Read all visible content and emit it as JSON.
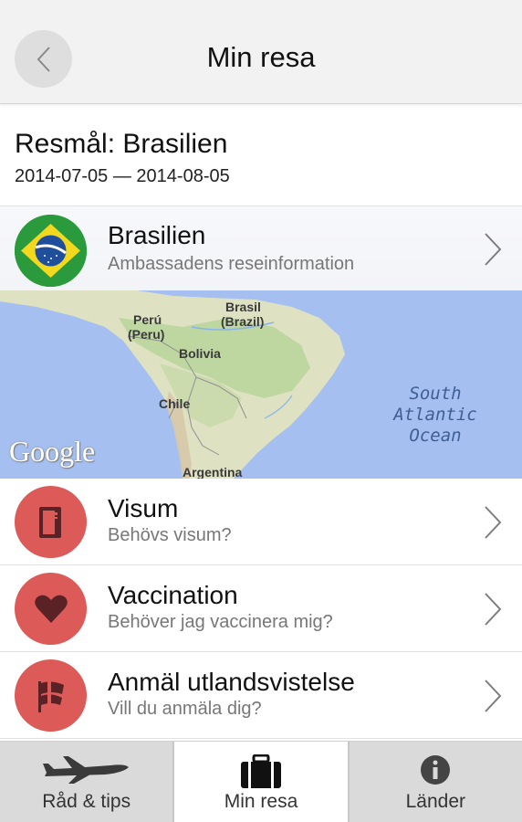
{
  "header": {
    "title": "Min resa",
    "back_icon": "chevron-left-icon"
  },
  "trip": {
    "title": "Resmål: Brasilien",
    "dates": "2014-07-05 — 2014-08-05"
  },
  "country": {
    "name": "Brasilien",
    "subtitle": "Ambassadens reseinformation",
    "icon": "brazil-flag-icon"
  },
  "map": {
    "labels": {
      "brasil": "Brasil",
      "brasil_alt": "(Brazil)",
      "peru": "Perú",
      "peru_alt": "(Peru)",
      "bolivia": "Bolivia",
      "chile": "Chile",
      "argentina": "Argentina",
      "ocean_line1": "South",
      "ocean_line2": "Atlantic",
      "ocean_line3": "Ocean"
    },
    "logo": "Google"
  },
  "items": [
    {
      "title": "Visum",
      "subtitle": "Behövs visum?",
      "icon": "passport-icon"
    },
    {
      "title": "Vaccination",
      "subtitle": "Behöver jag vaccinera mig?",
      "icon": "heart-icon"
    },
    {
      "title": "Anmäl utlandsvistelse",
      "subtitle": "Vill du anmäla dig?",
      "icon": "flag-icon"
    }
  ],
  "nav": [
    {
      "label": "Råd & tips",
      "icon": "airplane-icon",
      "active": false
    },
    {
      "label": "Min resa",
      "icon": "suitcase-icon",
      "active": true
    },
    {
      "label": "Länder",
      "icon": "info-icon",
      "active": false
    }
  ],
  "colors": {
    "accent_red": "#dc5a57",
    "header_bg": "#f2f2f2",
    "nav_bg": "#dadada"
  }
}
